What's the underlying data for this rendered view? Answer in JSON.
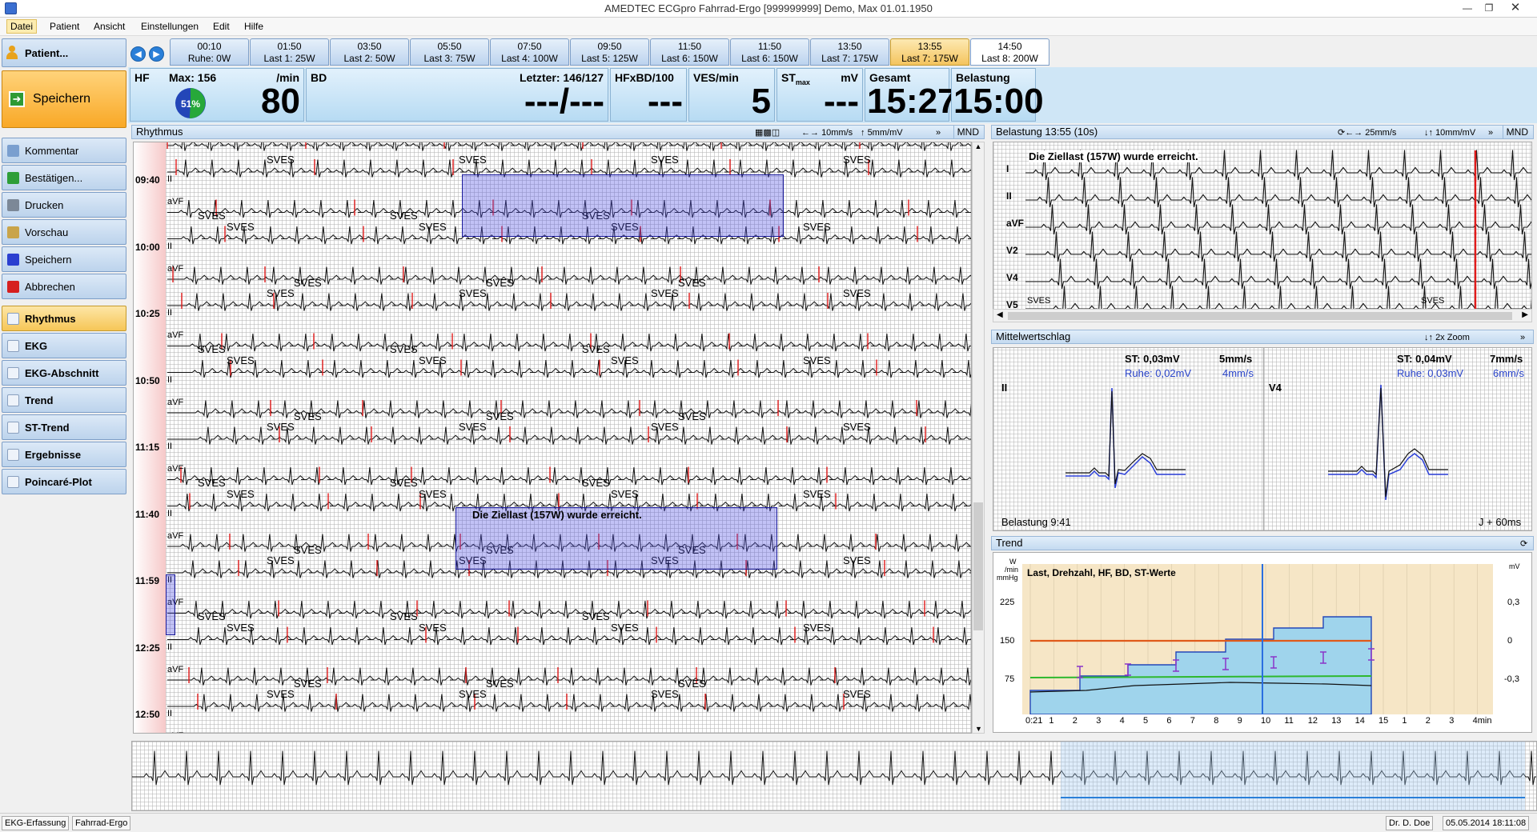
{
  "window": {
    "title": "AMEDTEC ECGpro    Fahrrad-Ergo    [999999999] Demo, Max 01.01.1950"
  },
  "menu": [
    "Datei",
    "Patient",
    "Ansicht",
    "Einstellungen",
    "Edit",
    "Hilfe"
  ],
  "sidebar": {
    "patient": "Patient...",
    "save_big": "Speichern",
    "actions": [
      "Kommentar",
      "Bestätigen...",
      "Drucken",
      "Vorschau",
      "Speichern",
      "Abbrechen"
    ],
    "views": [
      "Rhythmus",
      "EKG",
      "EKG-Abschnitt",
      "Trend",
      "ST-Trend",
      "Ergebnisse",
      "Poincaré-Plot"
    ],
    "selected_view": "Rhythmus"
  },
  "stages": [
    {
      "time": "00:10",
      "label": "Ruhe: 0W"
    },
    {
      "time": "01:50",
      "label": "Last 1: 25W"
    },
    {
      "time": "03:50",
      "label": "Last 2: 50W"
    },
    {
      "time": "05:50",
      "label": "Last 3: 75W"
    },
    {
      "time": "07:50",
      "label": "Last 4: 100W"
    },
    {
      "time": "09:50",
      "label": "Last 5: 125W"
    },
    {
      "time": "11:50",
      "label": "Last 6: 150W"
    },
    {
      "time": "11:50",
      "label": "Last 6: 150W"
    },
    {
      "time": "13:50",
      "label": "Last 7: 175W"
    },
    {
      "time": "13:55",
      "label": "Last 7: 175W"
    },
    {
      "time": "14:50",
      "label": "Last 8: 200W"
    }
  ],
  "current_stage": 9,
  "vitals": {
    "hf": {
      "label": "HF",
      "max": "Max: 156",
      "unit": "/min",
      "value": "80",
      "gauge": "51%",
      "gauge_fraction": 0.51
    },
    "bd": {
      "label": "BD",
      "last": "Letzter: 146/127",
      "value": "---/---"
    },
    "hfxbd": {
      "label": "HFxBD/100",
      "value": "---"
    },
    "ves": {
      "label": "VES/min",
      "value": "5"
    },
    "st": {
      "label": "ST",
      "sub": "max",
      "unit": "mV",
      "value": "---"
    },
    "gesamt": {
      "label": "Gesamt",
      "value": "15:27"
    },
    "belastung": {
      "label": "Belastung",
      "value": "15:00"
    }
  },
  "rhythm": {
    "title": "Rhythmus",
    "speed": "10mm/s",
    "gain": "5mm/mV",
    "mnd": "MND",
    "times": [
      "09:40",
      "10:00",
      "10:25",
      "10:50",
      "11:15",
      "11:40",
      "11:59",
      "12:25",
      "12:50"
    ],
    "leads": [
      "II",
      "aVF"
    ],
    "marker": "SVES",
    "note": "Die Ziellast (157W) wurde erreicht."
  },
  "belastung_panel": {
    "title": "Belastung 13:55 (10s)",
    "speed": "25mm/s",
    "gain": "10mm/mV",
    "mnd": "MND",
    "leads": [
      "I",
      "II",
      "aVF",
      "V2",
      "V4",
      "V5"
    ],
    "note": "Die Ziellast (157W) wurde erreicht.",
    "marker": "SVES"
  },
  "mittel": {
    "title": "Mittelwertschlag",
    "zoom": "2x Zoom",
    "left": {
      "lead": "II",
      "st": "ST:  0,03mV",
      "speed": "5mm/s",
      "ruhe": "Ruhe: 0,02mV",
      "ruhe_speed": "4mm/s"
    },
    "right": {
      "lead": "V4",
      "st": "ST:  0,04mV",
      "speed": "7mm/s",
      "ruhe": "Ruhe: 0,03mV",
      "ruhe_speed": "6mm/s"
    },
    "footer_left": "Belastung 9:41",
    "footer_right": "J + 60ms"
  },
  "trend": {
    "title": "Trend",
    "heading": "Last, Drehzahl, HF, BD, ST-Werte",
    "yunit_left": [
      "W",
      "/min",
      "mmHg"
    ],
    "yticks_left": [
      "225",
      "150",
      "75"
    ],
    "yunit_right": "mV",
    "yticks_right": [
      "0,3",
      "0",
      "-0,3"
    ],
    "xticks": [
      "0:21",
      "1",
      "2",
      "3",
      "4",
      "5",
      "6",
      "7",
      "8",
      "9",
      "10",
      "11",
      "12",
      "13",
      "14",
      "15",
      "1",
      "2",
      "3",
      "4min"
    ]
  },
  "status": {
    "left1": "EKG-Erfassung",
    "left2": "Fahrrad-Ergo",
    "user": "Dr. D. Doe",
    "datetime": "05.05.2014 18:11:08"
  },
  "colors": {
    "accent": "#f9a826",
    "panel": "#c4daf0",
    "ecg": "#111111",
    "pvc": "#e21a1a",
    "selection": "#5050e6"
  }
}
